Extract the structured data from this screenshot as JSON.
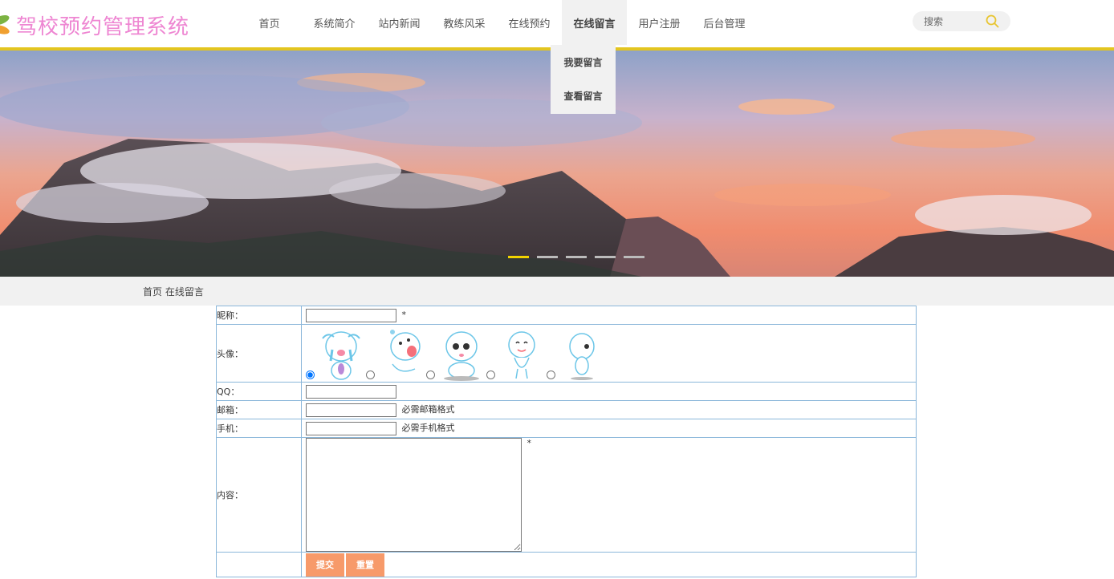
{
  "site": {
    "title": "驾校预约管理系统"
  },
  "nav": {
    "items": [
      "首页",
      "系统简介",
      "站内新闻",
      "教练风采",
      "在线预约",
      "在线留言",
      "用户注册",
      "后台管理"
    ],
    "active_index": 5,
    "dropdown": [
      "我要留言",
      "查看留言"
    ]
  },
  "search": {
    "placeholder": "搜索",
    "icon": "search-icon"
  },
  "banner": {
    "slide_count": 5,
    "active_slide": 0,
    "active_color": "#f2d300"
  },
  "breadcrumb": {
    "home": "首页",
    "current": "在线留言"
  },
  "form": {
    "nickname_label": "昵称：",
    "nickname_value": "",
    "required_mark": "*",
    "avatar_label": "头像：",
    "avatar_selected": 0,
    "avatar_count": 5,
    "qq_label": "QQ：",
    "qq_value": "",
    "email_label": "邮箱：",
    "email_value": "",
    "email_hint": "必需邮箱格式",
    "phone_label": "手机：",
    "phone_value": "",
    "phone_hint": "必需手机格式",
    "content_label": "内容：",
    "content_value": "",
    "content_required": "*",
    "submit_label": "提交",
    "reset_label": "重置"
  },
  "colors": {
    "accent_yellow": "#e3c520",
    "logo_pink": "#ee86d2",
    "button_orange": "#f79a6a",
    "table_border": "#8bb7da"
  }
}
